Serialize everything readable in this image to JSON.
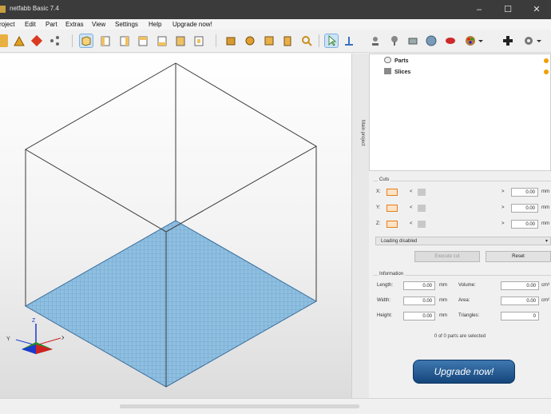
{
  "window": {
    "title": "netfabb Basic 7.4",
    "controls": {
      "minimize": "–",
      "maximize": "☐",
      "close": "✕"
    }
  },
  "menu": [
    "roject",
    "Edit",
    "Part",
    "Extras",
    "View",
    "Settings",
    "Help",
    "Upgrade now!"
  ],
  "toolbar": {
    "icons": [
      "add-part-icon",
      "triangle-icon",
      "repair-icon",
      "view-perspective-icon",
      "view-front-icon",
      "view-left-icon",
      "view-right-icon",
      "view-top-icon",
      "view-bottom-icon",
      "view-back-icon",
      "move-icon",
      "rotate-icon",
      "scale-icon",
      "search-icon",
      "pointer-icon",
      "measure-icon",
      "object-icon",
      "tree-icon",
      "ruler-icon",
      "sphere-icon",
      "section-icon",
      "palette-icon",
      "plus-icon",
      "settings-icon"
    ],
    "selected": [
      "view-perspective-icon",
      "pointer-icon"
    ]
  },
  "colors": {
    "platform": "#7fb2d8",
    "orange": "#e08020",
    "accent_dark": "#14457b",
    "accent_light": "#3f78b0"
  },
  "side_tab": "Main project",
  "tree": {
    "nodes": [
      {
        "label": "Parts",
        "icon": "parts-icon"
      },
      {
        "label": "Slices",
        "icon": "slices-icon"
      }
    ]
  },
  "cuts": {
    "title": "Cuts",
    "rows": [
      {
        "axis": "X:",
        "sign": "<",
        "op": ">",
        "value": "0.00",
        "unit": "mm"
      },
      {
        "axis": "Y:",
        "sign": "<",
        "op": ">",
        "value": "0.00",
        "unit": "mm"
      },
      {
        "axis": "Z:",
        "sign": "<",
        "op": ">",
        "value": "0.00",
        "unit": "mm"
      }
    ],
    "mode": "Loading disabled",
    "execute_label": "Execute cut",
    "reset_label": "Reset"
  },
  "information": {
    "title": "Information",
    "left": [
      {
        "label": "Length:",
        "value": "0.00",
        "unit": "mm"
      },
      {
        "label": "Width:",
        "value": "0.00",
        "unit": "mm"
      },
      {
        "label": "Height:",
        "value": "0.00",
        "unit": "mm"
      }
    ],
    "right": [
      {
        "label": "Volume:",
        "value": "0.00",
        "unit": "cm³"
      },
      {
        "label": "Area:",
        "value": "0.00",
        "unit": "cm²"
      },
      {
        "label": "Triangles:",
        "value": "0",
        "unit": ""
      }
    ]
  },
  "selection_text": "0 of 0 parts are selected",
  "upgrade_label": "Upgrade now!",
  "axes": {
    "x": "X",
    "y": "Y",
    "z": "Z"
  }
}
